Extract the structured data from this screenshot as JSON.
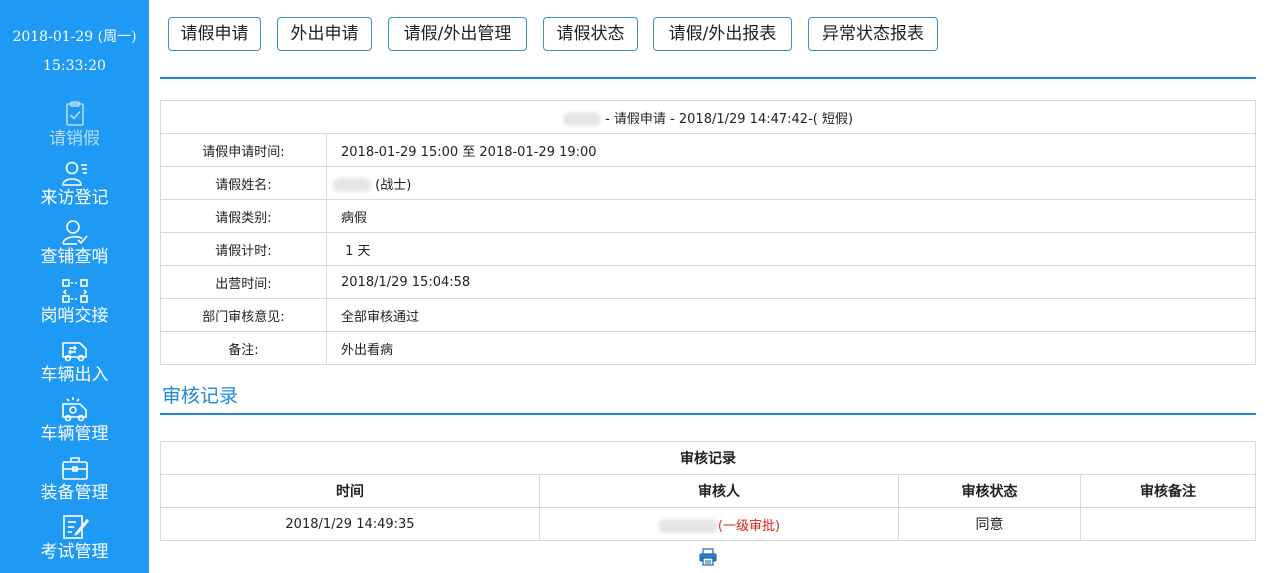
{
  "sidebar": {
    "date": "2018-01-29 (周一)",
    "time": "15:33:20",
    "items": [
      {
        "label": "请销假",
        "icon": "clipboard-check-icon"
      },
      {
        "label": "来访登记",
        "icon": "user-list-icon"
      },
      {
        "label": "查铺查哨",
        "icon": "user-check-icon"
      },
      {
        "label": "岗哨交接",
        "icon": "exchange-icon"
      },
      {
        "label": "车辆出入",
        "icon": "vehicle-exchange-icon"
      },
      {
        "label": "车辆管理",
        "icon": "vehicle-manage-icon"
      },
      {
        "label": "装备管理",
        "icon": "briefcase-icon"
      },
      {
        "label": "考试管理",
        "icon": "exam-edit-icon"
      }
    ],
    "active_index": 0
  },
  "toolbar": {
    "buttons": [
      "请假申请",
      "外出申请",
      "请假/外出管理",
      "请假状态",
      "请假/外出报表",
      "异常状态报表"
    ]
  },
  "detail": {
    "title_suffix": "- 请假申请  -  2018/1/29 14:47:42-( 短假)",
    "rows": [
      {
        "key": "请假申请时间:",
        "value": "2018-01-29 15:00 至 2018-01-29 19:00"
      },
      {
        "key": "请假姓名:",
        "value": "(战士)"
      },
      {
        "key": "请假类别:",
        "value": "病假"
      },
      {
        "key": "请假计时:",
        "value": " 1 天"
      },
      {
        "key": "出营时间:",
        "value": "2018/1/29 15:04:58"
      },
      {
        "key": "部门审核意见:",
        "value": "全部审核通过"
      },
      {
        "key": "备注:",
        "value": "外出看病"
      }
    ]
  },
  "audit": {
    "section_title": "审核记录",
    "table_title": "审核记录",
    "headers": [
      "时间",
      "审核人",
      "审核状态",
      "审核备注"
    ],
    "rows": [
      {
        "time": "2018/1/29 14:49:35",
        "auditor_suffix": "(一级审批)",
        "status": "同意",
        "remark": ""
      }
    ]
  },
  "colors": {
    "sidebar_bg": "#1e9af5",
    "accent": "#1e88d6",
    "danger": "#d9241b"
  },
  "print_icon": "printer-icon"
}
